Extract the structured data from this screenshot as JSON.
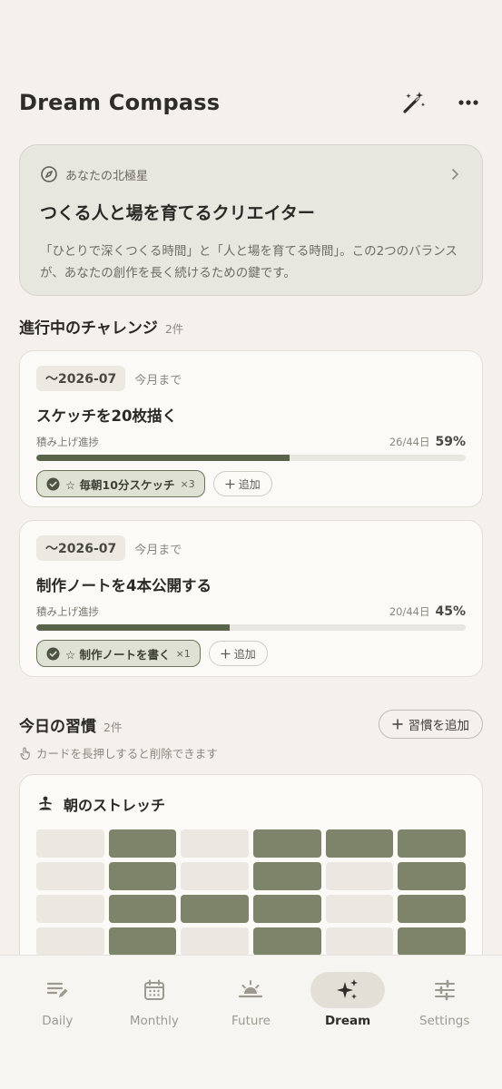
{
  "app": {
    "title": "Dream Compass"
  },
  "north_star": {
    "label": "あなたの北極星",
    "title": "つくる人と場を育てるクリエイター",
    "description": "「ひとりで深くつくる時間」と「人と場を育てる時間」。この2つのバランスが、あなたの創作を長く続けるための鍵です。"
  },
  "challenges_section": {
    "title": "進行中のチャレンジ",
    "count": "2件"
  },
  "challenges": [
    {
      "deadline": "〜2026-07",
      "deadline_note": "今月まで",
      "title": "スケッチを20枚描く",
      "progress_label": "積み上げ進捗",
      "days": "26/44日",
      "percent": "59%",
      "progress_fraction": 0.59,
      "habit_chip": "☆ 毎朝10分スケッチ",
      "habit_multiplier": "×3",
      "add_label": "追加"
    },
    {
      "deadline": "〜2026-07",
      "deadline_note": "今月まで",
      "title": "制作ノートを4本公開する",
      "progress_label": "積み上げ進捗",
      "days": "20/44日",
      "percent": "45%",
      "progress_fraction": 0.45,
      "habit_chip": "☆ 制作ノートを書く",
      "habit_multiplier": "×1",
      "add_label": "追加"
    }
  ],
  "habits_section": {
    "title": "今日の習慣",
    "count": "2件",
    "add_button": "習慣を追加",
    "hint": "カードを長押しすると削除できます"
  },
  "habit": {
    "name": "朝のストレッチ",
    "grid": [
      [
        0,
        1,
        0,
        1,
        1,
        1
      ],
      [
        0,
        1,
        0,
        1,
        0,
        1
      ],
      [
        0,
        1,
        1,
        1,
        0,
        1
      ],
      [
        0,
        1,
        0,
        1,
        0,
        1
      ]
    ]
  },
  "tabs": [
    {
      "label": "Daily",
      "icon": "daily-note-icon",
      "active": false
    },
    {
      "label": "Monthly",
      "icon": "calendar-icon",
      "active": false
    },
    {
      "label": "Future",
      "icon": "sunrise-icon",
      "active": false
    },
    {
      "label": "Dream",
      "icon": "sparkles-icon",
      "active": true
    },
    {
      "label": "Settings",
      "icon": "sliders-icon",
      "active": false
    }
  ],
  "colors": {
    "accent": "#59644a",
    "habit_on": "#7e8469",
    "background": "#f4f1ec"
  }
}
